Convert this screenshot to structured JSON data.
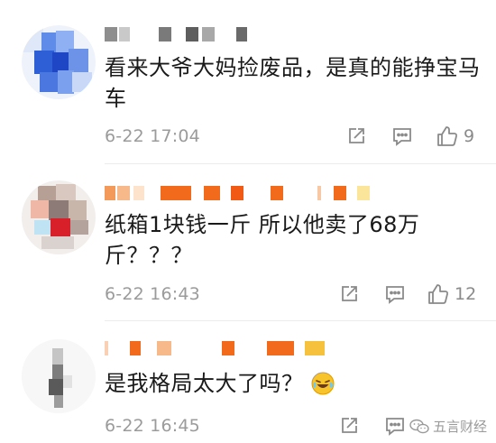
{
  "comments": [
    {
      "text": "看来大爷大妈捡废品，是真的能挣宝马车",
      "time": "6-22 17:04",
      "likes": "9",
      "share_icon": "share-icon",
      "reply_icon": "comment-icon",
      "like_icon": "thumbs-up-icon"
    },
    {
      "text": "纸箱1块钱一斤 所以他卖了68万斤？？？",
      "time": "6-22 16:43",
      "likes": "12",
      "share_icon": "share-icon",
      "reply_icon": "comment-icon",
      "like_icon": "thumbs-up-icon"
    },
    {
      "text": "是我格局太大了吗？",
      "time": "6-22 16:45",
      "likes": "",
      "emoji": "laughing-crying-emoji",
      "share_icon": "share-icon",
      "reply_icon": "comment-icon",
      "like_icon": "thumbs-up-icon"
    }
  ],
  "watermark": {
    "text": "五言财经",
    "icon": "wechat-icon"
  },
  "colors": {
    "timestamp": "#9b9b9b",
    "action": "#8a8a8a",
    "username_orange": "#f26b1d",
    "username_yellow": "#f6c23e",
    "username_gray": "#9a9a9a"
  }
}
